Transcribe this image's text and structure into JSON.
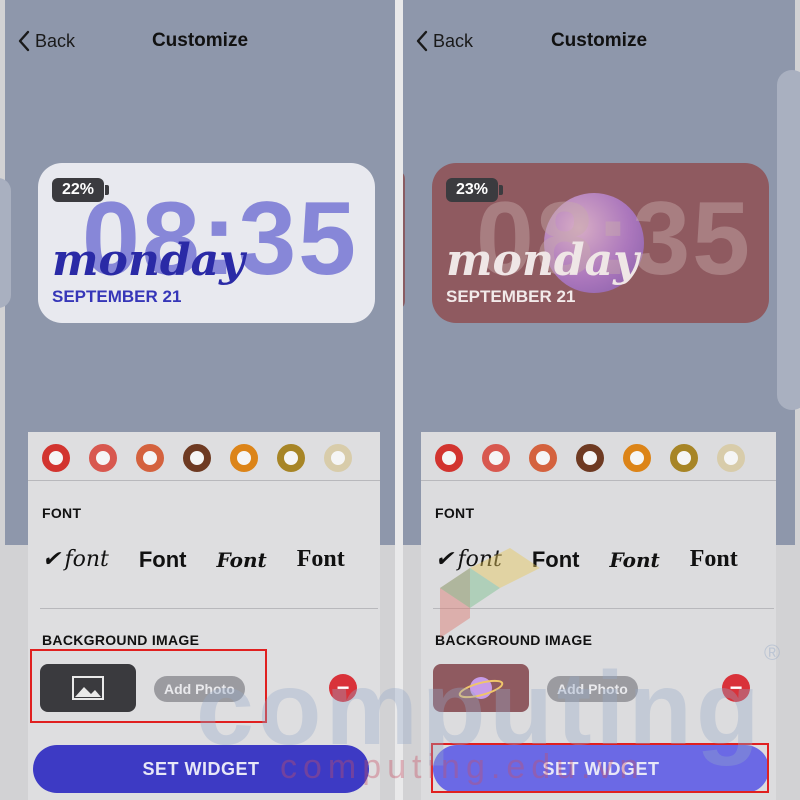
{
  "left": {
    "nav": {
      "back_label": "Back",
      "title": "Customize"
    },
    "widget": {
      "battery": "22%",
      "time": "08:35",
      "day": "monday",
      "date": "SEPTEMBER 21"
    },
    "swatches": [
      "#d2342f",
      "#d8584f",
      "#d4623e",
      "#6e3a22",
      "#dc8418",
      "#a78526",
      "#d8ccaa"
    ],
    "font_label": "FONT",
    "fonts": [
      "font",
      "Font",
      "Font",
      "Font"
    ],
    "selected_check": "✔",
    "bg_label": "BACKGROUND IMAGE",
    "add_photo": "Add Photo",
    "remove": "−",
    "set_widget": "SET WIDGET"
  },
  "right": {
    "nav": {
      "back_label": "Back",
      "title": "Customize"
    },
    "widget": {
      "battery": "23%",
      "time": "08:35",
      "day": "monday",
      "date": "SEPTEMBER 21"
    },
    "swatches": [
      "#d2342f",
      "#d8584f",
      "#d4623e",
      "#6e3a22",
      "#dc8418",
      "#a78526",
      "#d8ccaa"
    ],
    "font_label": "FONT",
    "fonts": [
      "font",
      "Font",
      "Font",
      "Font"
    ],
    "selected_check": "✔",
    "bg_label": "BACKGROUND IMAGE",
    "add_photo": "Add Photo",
    "remove": "−",
    "set_widget": "SET WIDGET"
  },
  "watermark": {
    "brand": "computing",
    "url": "computing.edu.vn",
    "reg": "®"
  },
  "colors": {
    "accent": "#3d3ac4",
    "highlight": "#e02020",
    "top_bg": "#8e97ab"
  }
}
